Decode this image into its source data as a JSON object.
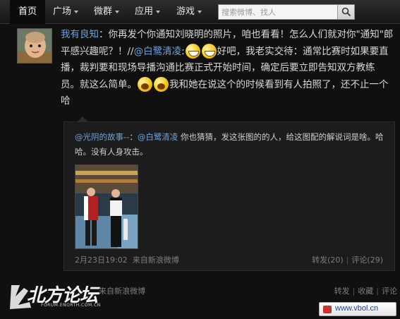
{
  "nav": {
    "items": [
      {
        "label": "首页",
        "has_caret": false
      },
      {
        "label": "广场",
        "has_caret": true
      },
      {
        "label": "微群",
        "has_caret": true
      },
      {
        "label": "应用",
        "has_caret": true
      },
      {
        "label": "游戏",
        "has_caret": true
      }
    ],
    "search_placeholder": "搜索微博、找人"
  },
  "post": {
    "author": "我有良知",
    "text_1": "：你再发个你通知刘晓明的照片，咱也看看！怎么人们就对你\"通知\"郎平感兴趣呢？！",
    "text_2": "//",
    "mention": "@白鹭清凌",
    "text_3": ":",
    "text_4": "好吧，我老实交待：通常比赛时如果要直播，裁判要和现场导播沟通比赛正式开始时间，确定后要立即告知双方教练员。就这么简单。",
    "text_5": "我和她在说这个的时候看到有人拍照了，还不止一个哈"
  },
  "quoted": {
    "author": "@光阴的故事--",
    "colon": "：",
    "mention": "@白鹭清凌",
    "text": "你也猜猜，发这张图的的人，给这图配的解说词是啥。哈哈。没有人身攻击。",
    "time": "2月23日19:02",
    "source": "来自新浪微博",
    "repost": "转发(20)",
    "comment": "评论(29)"
  },
  "footer": {
    "source": "来自新浪微博",
    "repost": "转发",
    "favorite": "收藏",
    "comment": "评论"
  },
  "watermark": {
    "logo": "北方论坛",
    "sub": "FORUM.ENORTH.COM.CN",
    "site": "www.vbol.cn"
  },
  "colors": {
    "link": "#6fa2d8",
    "background": "#101010"
  }
}
